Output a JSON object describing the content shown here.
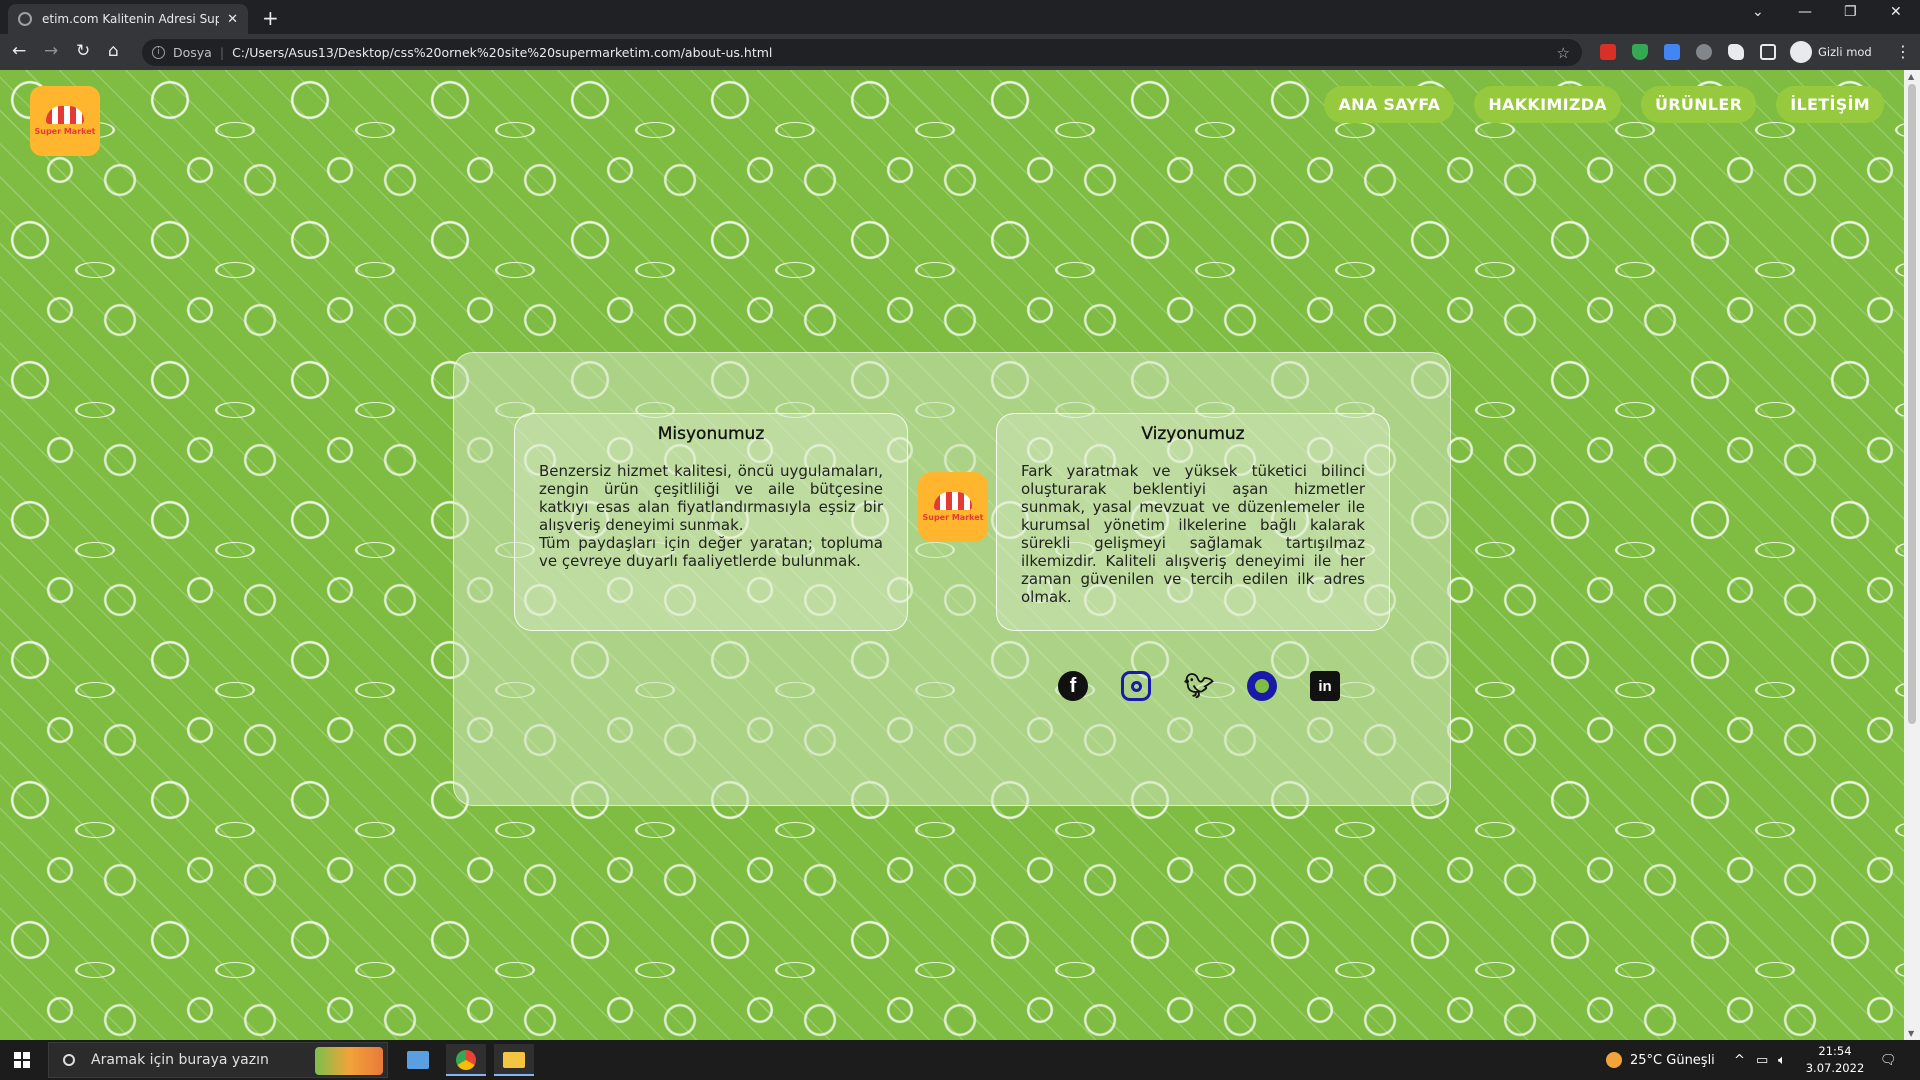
{
  "browser": {
    "tab_title": "etim.com Kalitenin Adresi Super",
    "new_tab": "+",
    "url_scheme_label": "Dosya",
    "url": "C:/Users/Asus13/Desktop/css%20ornek%20site%20supermarketim.com/about-us.html",
    "profile_label": "Gizli mod"
  },
  "site": {
    "logo_text": "Super Market",
    "nav": [
      "ANA SAYFA",
      "HAKKIMIZDA",
      "ÜRÜNLER",
      "İLETİŞİM"
    ],
    "accent_color": "#7ebd41",
    "nav_button_color": "#96c93d",
    "logo_color": "#ffb62e"
  },
  "about": {
    "mission": {
      "title": "Misyonumuz",
      "text1": "Benzersiz hizmet kalitesi, öncü uygulamaları, zengin ürün çeşitliliği ve aile bütçesine katkıyı esas alan fiyatlandırmasıyla eşsiz bir alışveriş deneyimi sunmak.",
      "text2": "Tüm paydaşları için değer yaratan; topluma ve çevreye duyarlı faaliyetlerde bulunmak."
    },
    "vision": {
      "title": "Vizyonumuz",
      "text": "Fark yaratmak ve yüksek tüketici bilinci oluşturarak beklentiyi aşan hizmetler sunmak, yasal mevzuat ve düzenlemeler ile kurumsal yönetim ilkelerine bağlı kalarak sürekli gelişmeyi sağlamak tartışılmaz ilkemizdir. Kaliteli alışveriş deneyimi ile her zaman güvenilen ve tercih edilen ilk adres olmak."
    },
    "social_icons": [
      "facebook-icon",
      "instagram-icon",
      "twitter-icon",
      "github-icon",
      "linkedin-icon"
    ]
  },
  "taskbar": {
    "search_placeholder": "Aramak için buraya yazın",
    "weather": "25°C  Güneşli",
    "time": "21:54",
    "date": "3.07.2022"
  }
}
